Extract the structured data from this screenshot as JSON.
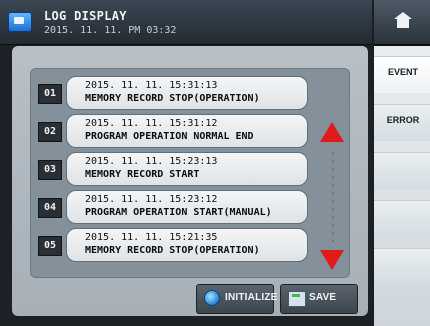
{
  "header": {
    "title": "LOG DISPLAY",
    "timestamp": "2015. 11. 11. PM 03:32"
  },
  "records": [
    {
      "num": "01",
      "datetime": "2015. 11. 11. 15:31:13",
      "message": "MEMORY RECORD STOP(OPERATION)"
    },
    {
      "num": "02",
      "datetime": "2015. 11. 11. 15:31:12",
      "message": "PROGRAM OPERATION NORMAL END"
    },
    {
      "num": "03",
      "datetime": "2015. 11. 11. 15:23:13",
      "message": "MEMORY RECORD START"
    },
    {
      "num": "04",
      "datetime": "2015. 11. 11. 15:23:12",
      "message": "PROGRAM OPERATION START(MANUAL)"
    },
    {
      "num": "05",
      "datetime": "2015. 11. 11. 15:21:35",
      "message": "MEMORY RECORD STOP(OPERATION)"
    }
  ],
  "buttons": {
    "initialize": "INITIALIZE",
    "save": "SAVE"
  },
  "side_tabs": {
    "event": "EVENT",
    "error": "ERROR"
  },
  "colors": {
    "scroll_arrow": "#e01a1a"
  },
  "icons": {
    "home": "home-icon",
    "app": "log-display-icon",
    "init": "initialize-icon",
    "save": "save-icon"
  }
}
